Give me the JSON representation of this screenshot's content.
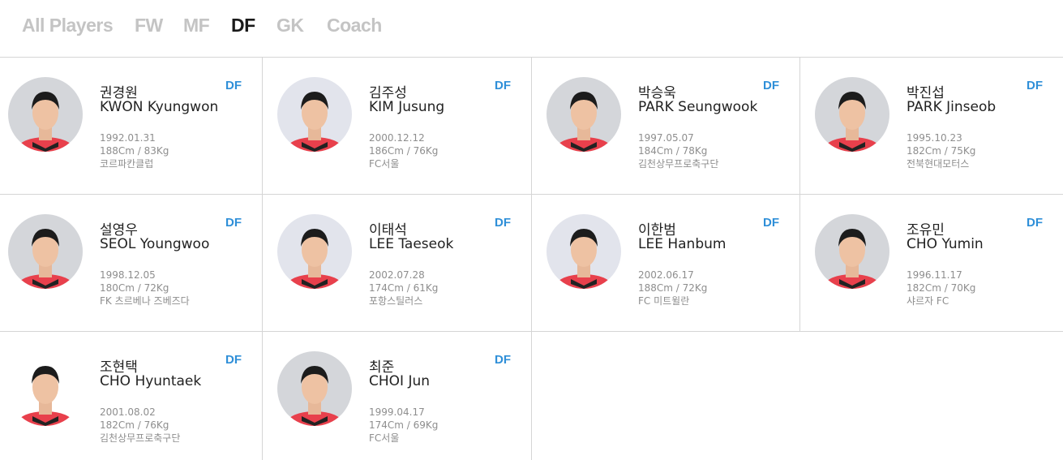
{
  "tabs": [
    {
      "label": "All Players",
      "active": false
    },
    {
      "label": "FW",
      "active": false
    },
    {
      "label": "MF",
      "active": false
    },
    {
      "label": "DF",
      "active": true
    },
    {
      "label": "GK",
      "active": false
    },
    {
      "label": "Coach",
      "active": false
    }
  ],
  "colors": {
    "position_badge": "#2f8fd8",
    "active_tab": "#1a1a1a",
    "inactive_tab": "#c4c4c4",
    "jersey": "#e8404c"
  },
  "players": [
    {
      "name_ko": "권경원",
      "name_en": "KWON Kyungwon",
      "position": "DF",
      "birth": "1992.01.31",
      "body": "188Cm / 83Kg",
      "club": "코르파칸클럽"
    },
    {
      "name_ko": "김주성",
      "name_en": "KIM Jusung",
      "position": "DF",
      "birth": "2000.12.12",
      "body": "186Cm / 76Kg",
      "club": "FC서울"
    },
    {
      "name_ko": "박승욱",
      "name_en": "PARK Seungwook",
      "position": "DF",
      "birth": "1997.05.07",
      "body": "184Cm / 78Kg",
      "club": "김천상무프로축구단"
    },
    {
      "name_ko": "박진섭",
      "name_en": "PARK Jinseob",
      "position": "DF",
      "birth": "1995.10.23",
      "body": "182Cm / 75Kg",
      "club": "전북현대모터스"
    },
    {
      "name_ko": "설영우",
      "name_en": "SEOL Youngwoo",
      "position": "DF",
      "birth": "1998.12.05",
      "body": "180Cm / 72Kg",
      "club": "FK 츠르베나 즈베즈다"
    },
    {
      "name_ko": "이태석",
      "name_en": "LEE Taeseok",
      "position": "DF",
      "birth": "2002.07.28",
      "body": "174Cm / 61Kg",
      "club": "포항스틸러스"
    },
    {
      "name_ko": "이한범",
      "name_en": "LEE Hanbum",
      "position": "DF",
      "birth": "2002.06.17",
      "body": "188Cm / 72Kg",
      "club": "FC 미트윌란"
    },
    {
      "name_ko": "조유민",
      "name_en": "CHO Yumin",
      "position": "DF",
      "birth": "1996.11.17",
      "body": "182Cm / 70Kg",
      "club": "샤르자 FC"
    },
    {
      "name_ko": "조현택",
      "name_en": "CHO Hyuntaek",
      "position": "DF",
      "birth": "2001.08.02",
      "body": "182Cm / 76Kg",
      "club": "김천상무프로축구단"
    },
    {
      "name_ko": "최준",
      "name_en": "CHOI Jun",
      "position": "DF",
      "birth": "1999.04.17",
      "body": "174Cm / 69Kg",
      "club": "FC서울"
    }
  ]
}
